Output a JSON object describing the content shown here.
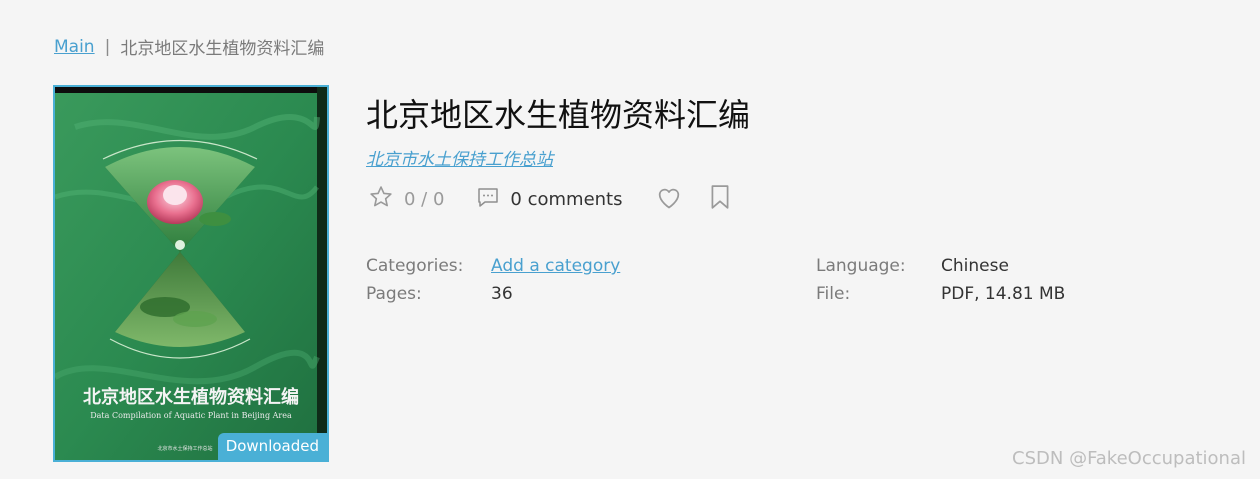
{
  "breadcrumb": {
    "home": "Main",
    "separator": "|",
    "current": "北京地区水生植物资料汇编"
  },
  "book": {
    "title": "北京地区水生植物资料汇编",
    "author": "北京市水土保持工作总站",
    "badge": "Downloaded",
    "cover": {
      "title_cn": "北京地区水生植物资料汇编",
      "title_en": "Data Compilation of Aquatic Plant in Beijing Area",
      "arc_text": "Data Compilation of Aquatic Plant in Beijing Area",
      "publisher": "北京市水土保持工作总站"
    }
  },
  "actions": {
    "rating": "0 / 0",
    "comments": "0 comments",
    "star_icon": "star-outline-icon",
    "comment_icon": "comment-icon",
    "favorite_icon": "heart-icon",
    "bookmark_icon": "bookmark-icon"
  },
  "meta": {
    "categories_label": "Categories:",
    "categories_value": "Add a category",
    "pages_label": "Pages:",
    "pages_value": "36",
    "language_label": "Language:",
    "language_value": "Chinese",
    "file_label": "File:",
    "file_value": "PDF, 14.81 MB"
  },
  "watermark": "CSDN @FakeOccupational",
  "colors": {
    "accent": "#49a0cf",
    "badge": "#4ab0d6",
    "cover_green": "#2f8a4f"
  }
}
